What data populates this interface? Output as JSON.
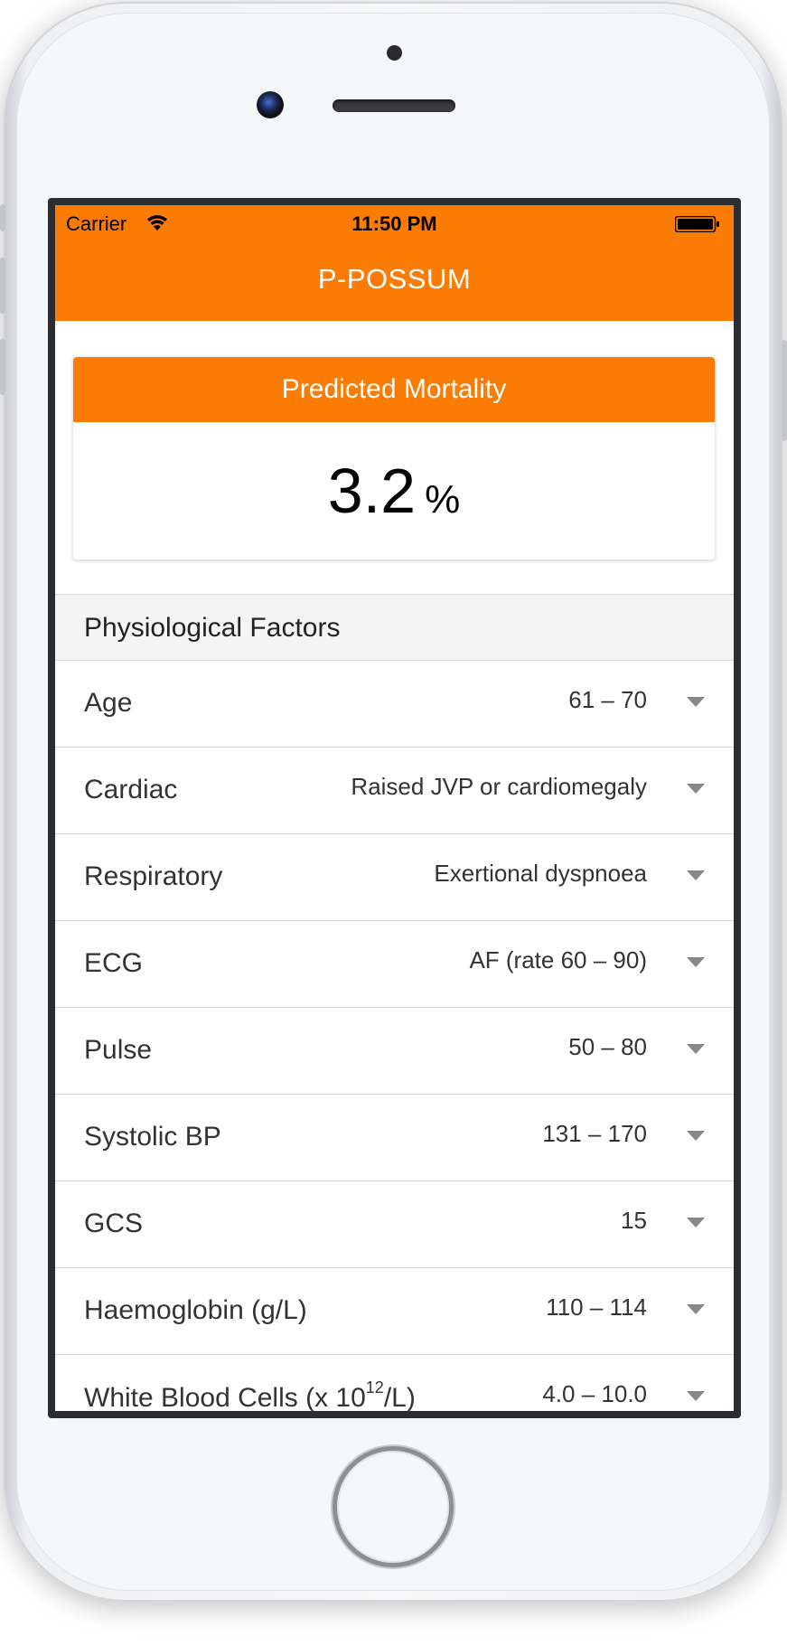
{
  "status_bar": {
    "carrier": "Carrier",
    "time": "11:50 PM"
  },
  "nav": {
    "title": "P-POSSUM"
  },
  "mortality_card": {
    "header": "Predicted Mortality",
    "value": "3.2",
    "unit": "%"
  },
  "physiological": {
    "section_title": "Physiological Factors",
    "rows": [
      {
        "label": "Age",
        "value": "61 – 70"
      },
      {
        "label": "Cardiac",
        "value": "Raised JVP or cardiomegaly"
      },
      {
        "label": "Respiratory",
        "value": "Exertional dyspnoea"
      },
      {
        "label": "ECG",
        "value": "AF (rate 60 – 90)"
      },
      {
        "label": "Pulse",
        "value": "50 – 80"
      },
      {
        "label": "Systolic BP",
        "value": "131 – 170"
      },
      {
        "label": "GCS",
        "value": "15"
      },
      {
        "label": "Haemoglobin (g/L)",
        "value": "110 – 114"
      },
      {
        "label_prefix": "White Blood Cells (x 10",
        "label_sup": "12",
        "label_suffix": "/L)",
        "value": "4.0 – 10.0"
      }
    ]
  },
  "colors": {
    "accent": "#fc7c03",
    "background": "#ffffff",
    "section_background": "#f4f4f4",
    "chevron": "#888888"
  },
  "icons": [
    "wifi-icon",
    "battery-icon",
    "chevron-down-icon"
  ]
}
